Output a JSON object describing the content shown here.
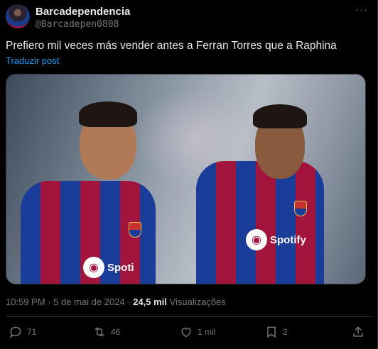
{
  "post": {
    "author_name": "Barcadependencia",
    "author_handle": "@Barcadepen0808",
    "more_label": "···",
    "text": "Prefiero mil veces más vender antes a Ferran Torres que a Raphina",
    "translate_label": "Traduzir post",
    "timestamp": "10:59 PM · 5 de mai de 2024 · ",
    "views_count": "24,5 mil",
    "views_label": " Visualizações"
  },
  "media": {
    "sponsor_1": "Spoti",
    "sponsor_2": "Spotify"
  },
  "actions": {
    "replies": "71",
    "reposts": "46",
    "likes": "1 mil",
    "bookmarks": "2"
  },
  "colors": {
    "background": "#000000",
    "text": "#e7e9ea",
    "muted": "#71767b",
    "link": "#1d9bf0",
    "divider": "#2f3336"
  }
}
